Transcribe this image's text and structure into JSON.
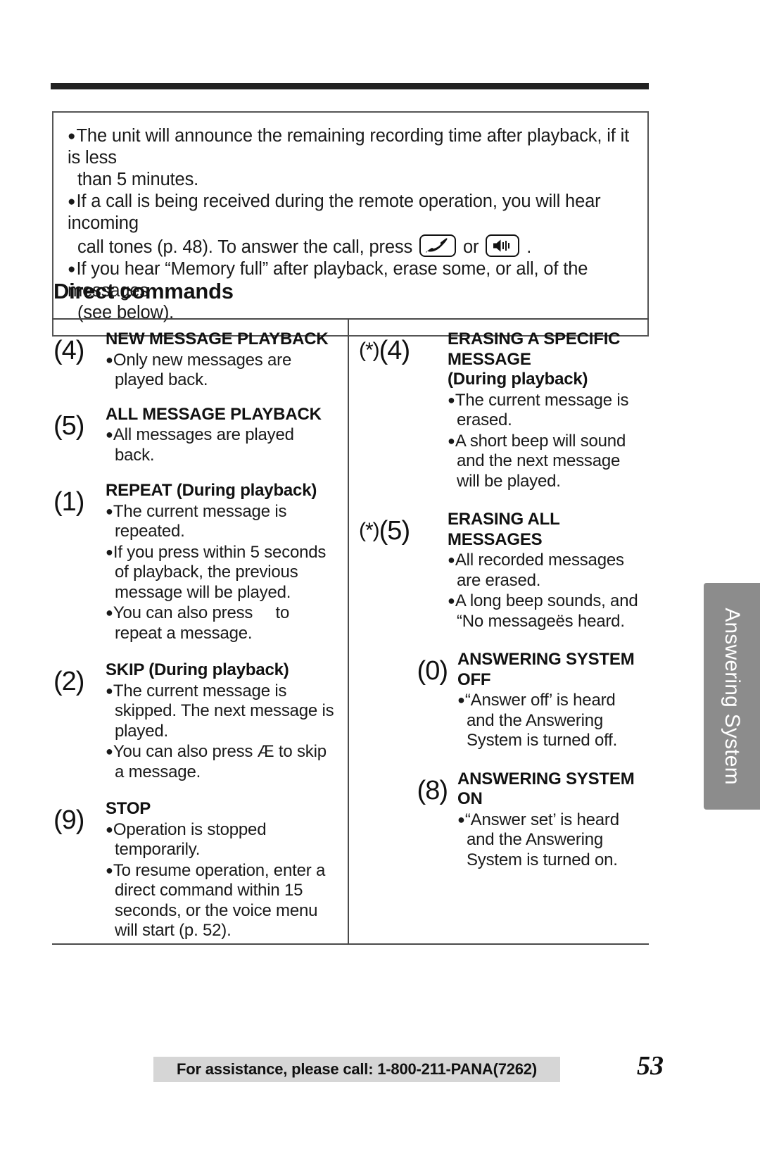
{
  "note_box": {
    "bullets": [
      {
        "lines": [
          "The unit will announce the remaining recording time after playback, if it is less",
          "than 5 minutes."
        ]
      },
      {
        "lines_pre": [
          "If a call is being received during the remote operation, you will hear incoming"
        ],
        "line_with_icons_pre": "call tones (p. 48). To answer the call, press",
        "line_with_icons_mid": "or",
        "line_with_icons_post": ".",
        "icon1": "talk-handset-key-icon",
        "icon2": "speakerphone-key-icon"
      },
      {
        "lines": [
          "If you hear “Memory full” after playback, erase some, or all, of the messages",
          "(see below)."
        ]
      }
    ]
  },
  "section": {
    "heading": "Direct commands"
  },
  "commands": {
    "left": [
      {
        "key": "(4)",
        "title": "NEW MESSAGE PLAYBACK",
        "items": [
          "Only new messages are played back."
        ]
      },
      {
        "key": "(5)",
        "title": "ALL MESSAGE PLAYBACK",
        "items": [
          "All messages are played back."
        ]
      },
      {
        "key": "(1)",
        "title": "REPEAT (During playback)",
        "items": [
          "The current message is repeated.",
          "If you press within 5 seconds of playback, the previous message will be played.",
          "You can also press     to repeat a message."
        ]
      },
      {
        "key": "(2)",
        "title": "SKIP (During playback)",
        "items": [
          "The current message is skipped. The next message is played.",
          "You can also press Æ  to skip a message."
        ]
      },
      {
        "key": "(9)",
        "title": "STOP",
        "items": [
          "Operation is stopped temporarily.",
          "To resume operation, enter a direct command within 15 seconds, or the voice menu will start (p. 52)."
        ]
      }
    ],
    "right": [
      {
        "key_star": "(*)",
        "key_num": "(4)",
        "title": "ERASING A SPECIFIC MESSAGE",
        "subtitle": "(During playback)",
        "items": [
          "The current message is erased.",
          "A short beep will sound and the next message will be played."
        ]
      },
      {
        "key_star": "(*)",
        "key_num": "(5)",
        "title": "ERASING ALL MESSAGES",
        "subtitle": "",
        "items": [
          "All recorded messages are erased.",
          "A long beep sounds, and “No messageës heard."
        ]
      },
      {
        "key_star": "",
        "key_num": "(0)",
        "title": "ANSWERING SYSTEM OFF",
        "subtitle": "",
        "items": [
          "“Answer off’ is heard and the Answering System is turned off."
        ]
      },
      {
        "key_star": "",
        "key_num": "(8)",
        "title": "ANSWERING SYSTEM ON",
        "subtitle": "",
        "items": [
          "“Answer set’ is heard and the Answering System is turned on."
        ]
      }
    ]
  },
  "side_tab": {
    "label": "Answering System",
    "color": "#8c8c8c"
  },
  "footer": {
    "assistance_text": "For assistance, please call: 1-800-211-PANA(7262)",
    "page_number": "53"
  }
}
